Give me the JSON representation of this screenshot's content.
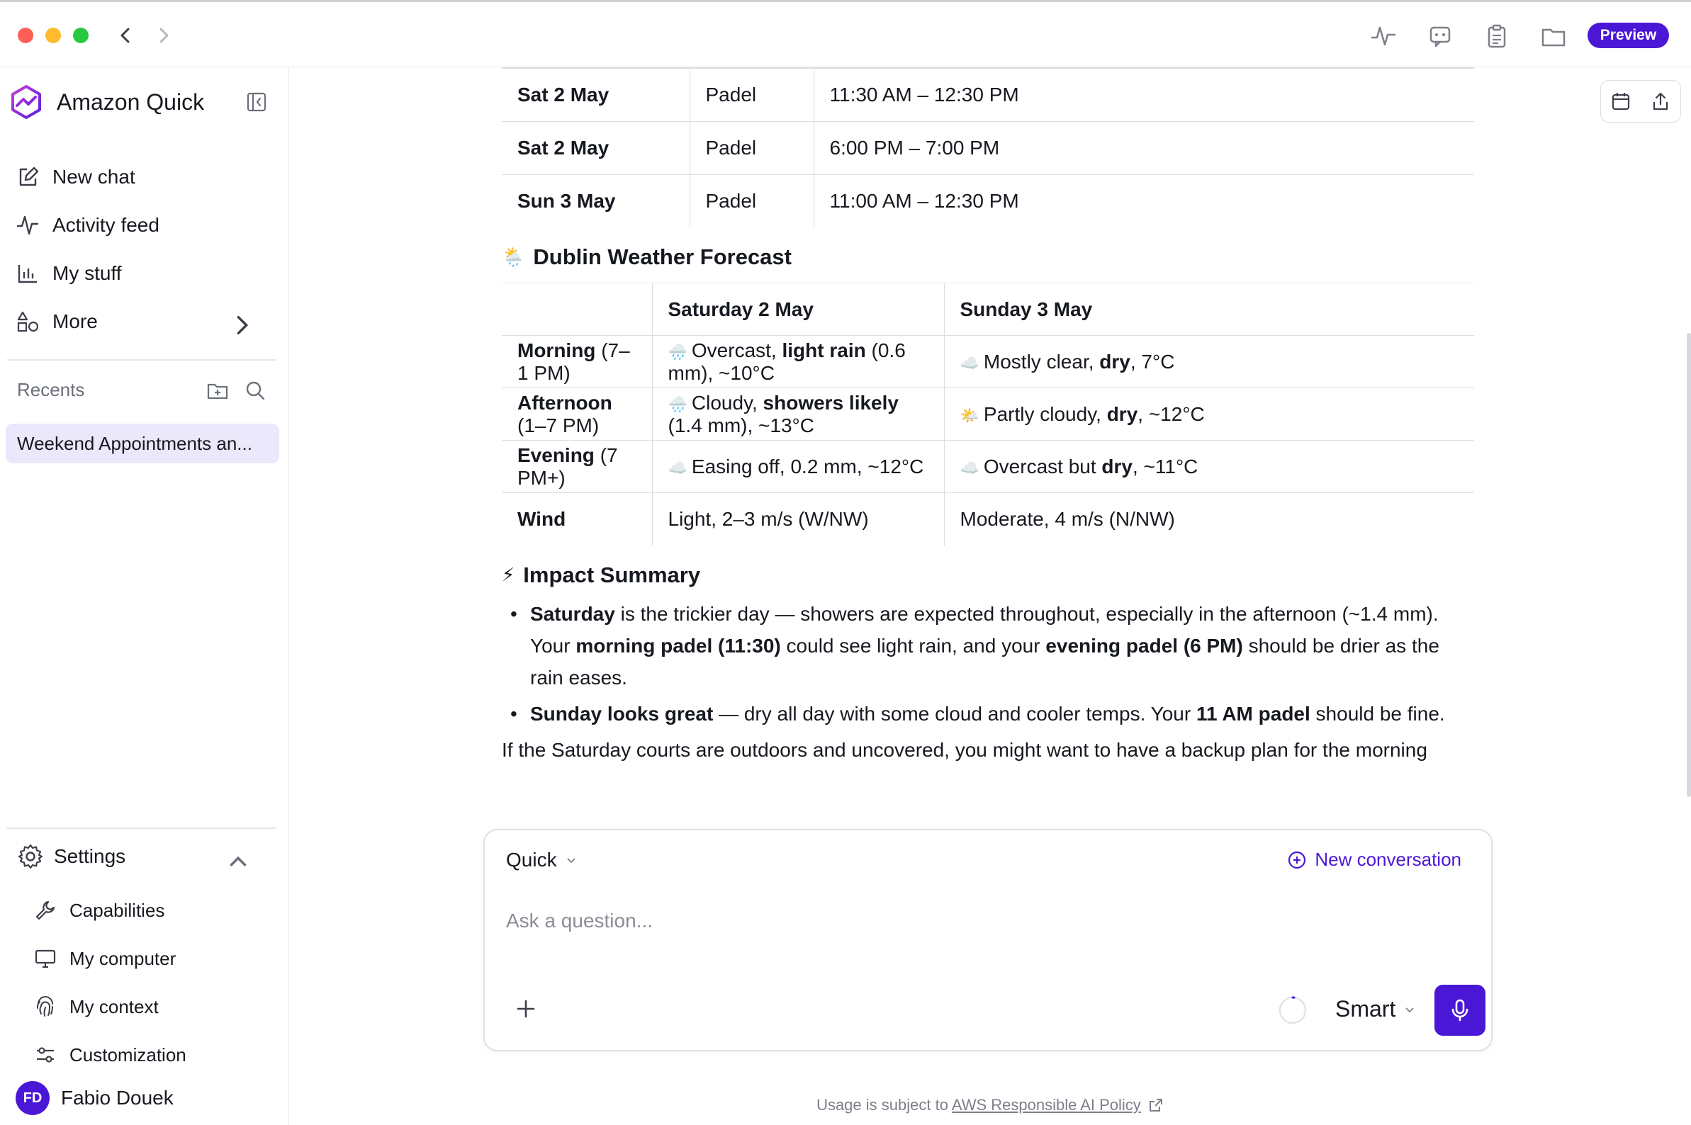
{
  "titlebar": {
    "preview_label": "Preview"
  },
  "sidebar": {
    "brand": "Amazon Quick",
    "nav": [
      {
        "label": "New chat",
        "icon": "edit-icon"
      },
      {
        "label": "Activity feed",
        "icon": "activity-icon"
      },
      {
        "label": "My stuff",
        "icon": "chart-icon"
      },
      {
        "label": "More",
        "icon": "shapes-icon"
      }
    ],
    "recents_label": "Recents",
    "recent_items": [
      "Weekend Appointments an..."
    ],
    "settings_label": "Settings",
    "settings_items": [
      {
        "label": "Capabilities",
        "icon": "wrench-icon"
      },
      {
        "label": "My computer",
        "icon": "monitor-icon"
      },
      {
        "label": "My context",
        "icon": "fingerprint-icon"
      },
      {
        "label": "Customization",
        "icon": "sliders-icon"
      }
    ],
    "user": {
      "initials": "FD",
      "name": "Fabio Douek"
    }
  },
  "schedule": [
    {
      "day": "Sat 2 May",
      "activity": "Padel",
      "time": "11:30 AM – 12:30 PM"
    },
    {
      "day": "Sat 2 May",
      "activity": "Padel",
      "time": "6:00 PM – 7:00 PM"
    },
    {
      "day": "Sun 3 May",
      "activity": "Padel",
      "time": "11:00 AM – 12:30 PM"
    }
  ],
  "weather": {
    "title": "Dublin Weather Forecast",
    "title_emoji": "🌦️",
    "headers": [
      "",
      "Saturday 2 May",
      "Sunday 3 May"
    ],
    "rows": [
      {
        "label_bold": "Morning",
        "label_rest": " (7–1 PM)",
        "sat": {
          "emoji": "🌧️",
          "parts": [
            [
              "Overcast, ",
              false
            ],
            [
              "light rain",
              true
            ],
            [
              " (0.6 mm), ~10°C",
              false
            ]
          ]
        },
        "sun": {
          "emoji": "☁️",
          "parts": [
            [
              "Mostly clear, ",
              false
            ],
            [
              "dry",
              true
            ],
            [
              ", 7°C",
              false
            ]
          ]
        }
      },
      {
        "label_bold": "Afternoon",
        "label_rest": " (1–7 PM)",
        "sat": {
          "emoji": "🌧️",
          "parts": [
            [
              "Cloudy, ",
              false
            ],
            [
              "showers likely",
              true
            ],
            [
              " (1.4 mm), ~13°C",
              false
            ]
          ]
        },
        "sun": {
          "emoji": "🌤️",
          "parts": [
            [
              "Partly cloudy, ",
              false
            ],
            [
              "dry",
              true
            ],
            [
              ", ~12°C",
              false
            ]
          ]
        }
      },
      {
        "label_bold": "Evening",
        "label_rest": " (7 PM+)",
        "sat": {
          "emoji": "☁️",
          "parts": [
            [
              "Easing off, 0.2 mm, ~12°C",
              false
            ]
          ]
        },
        "sun": {
          "emoji": "☁️",
          "parts": [
            [
              "Overcast but ",
              false
            ],
            [
              "dry",
              true
            ],
            [
              ", ~11°C",
              false
            ]
          ]
        }
      },
      {
        "label_bold": "Wind",
        "label_rest": "",
        "sat": {
          "emoji": "",
          "parts": [
            [
              "Light, 2–3 m/s (W/NW)",
              false
            ]
          ]
        },
        "sun": {
          "emoji": "",
          "parts": [
            [
              "Moderate, 4 m/s (N/NW)",
              false
            ]
          ]
        }
      }
    ]
  },
  "impact": {
    "title": "Impact Summary",
    "title_emoji": "⚡",
    "bullets": [
      [
        [
          "Saturday",
          true
        ],
        [
          " is the trickier day — showers are expected throughout, especially in the afternoon (~1.4 mm). Your ",
          false
        ],
        [
          "morning padel (11:30)",
          true
        ],
        [
          " could see light rain, and your ",
          false
        ],
        [
          "evening padel (6 PM)",
          true
        ],
        [
          " should be drier as the rain eases.",
          false
        ]
      ],
      [
        [
          "Sunday looks great",
          true
        ],
        [
          " — dry all day with some cloud and cooler temps. Your ",
          false
        ],
        [
          "11 AM padel",
          true
        ],
        [
          " should be fine.",
          false
        ]
      ]
    ],
    "trailing_text": "If the Saturday courts are outdoors and uncovered, you might want to have a backup plan for the morning"
  },
  "composer": {
    "mode": "Quick",
    "new_conversation": "New conversation",
    "placeholder": "Ask a question...",
    "model": "Smart"
  },
  "footer": {
    "prefix": "Usage is subject to ",
    "link": "AWS Responsible AI Policy"
  },
  "colors": {
    "accent": "#4a17d6",
    "recent_highlight": "#ece8fb"
  }
}
